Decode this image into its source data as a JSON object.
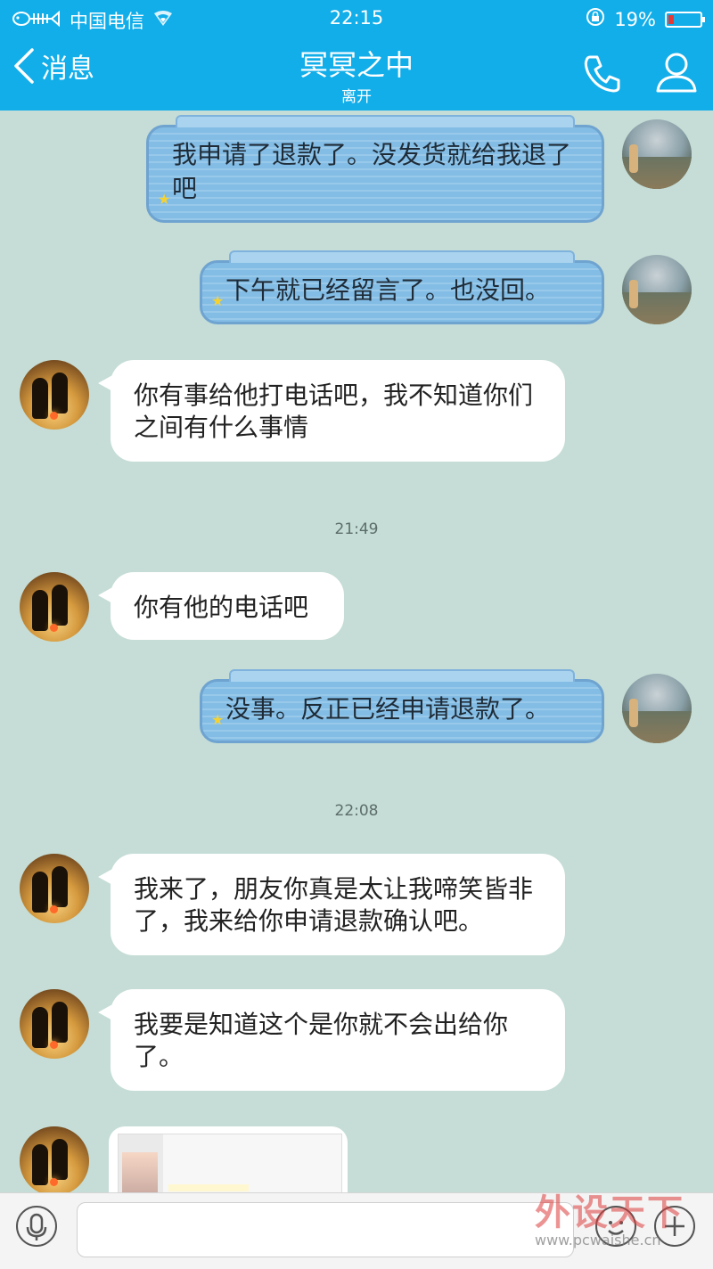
{
  "status_bar": {
    "carrier": "中国电信",
    "time": "22:15",
    "battery": "19%",
    "battery_level": 0.19
  },
  "nav": {
    "back_label": "消息",
    "title": "冥冥之中",
    "subtitle": "离开"
  },
  "messages": [
    {
      "from": "me",
      "text": "我申请了退款了。没发货就给我退了吧"
    },
    {
      "from": "me",
      "text": "下午就已经留言了。也没回。"
    },
    {
      "from": "other",
      "text": "你有事给他打电话吧，我不知道你们之间有什么事情"
    },
    {
      "timestamp": "21:49"
    },
    {
      "from": "other",
      "text": "你有他的电话吧"
    },
    {
      "from": "me",
      "text": "没事。反正已经申请退款了。"
    },
    {
      "timestamp": "22:08"
    },
    {
      "from": "other",
      "text": "我来了，朋友你真是太让我啼笑皆非了，我来给你申请退款确认吧。"
    },
    {
      "from": "other",
      "text": "我要是知道这个是你就不会出给你了。"
    },
    {
      "from": "other",
      "type": "image"
    }
  ],
  "input": {
    "value": "",
    "placeholder": ""
  },
  "watermark": {
    "brand": "外设天下",
    "url": "www.pcwaishe.cn"
  }
}
